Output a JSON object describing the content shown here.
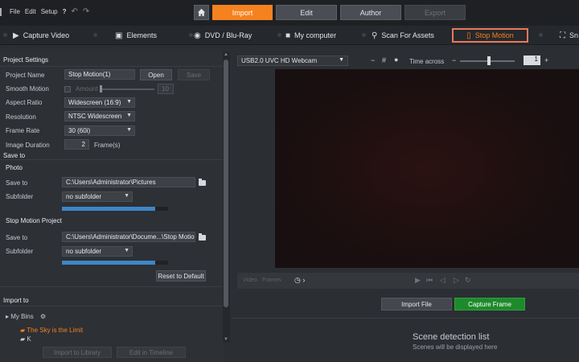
{
  "menu": {
    "items": [
      "File",
      "Edit",
      "Setup"
    ]
  },
  "top_tabs": [
    {
      "label": "Import",
      "state": "active"
    },
    {
      "label": "Edit",
      "state": "normal"
    },
    {
      "label": "Author",
      "state": "normal"
    },
    {
      "label": "Export",
      "state": "disabled"
    }
  ],
  "sources": {
    "capture_video": "Capture Video",
    "elements": "Elements",
    "dvd": "DVD / Blu-Ray",
    "my_computer": "My computer",
    "scan": "Scan For Assets",
    "stop_motion": "Stop Motion",
    "more": "Sn"
  },
  "project_settings": {
    "header": "Project Settings",
    "project_name_label": "Project Name",
    "project_name_value": "Stop Motion(1)",
    "open_button": "Open",
    "save_button": "Save",
    "smooth_motion_label": "Smooth Motion",
    "amount_label": "Amount",
    "amount_value": "10",
    "aspect_ratio_label": "Aspect Ratio",
    "aspect_ratio_value": "Widescreen (16:9)",
    "resolution_label": "Resolution",
    "resolution_value": "NTSC Widescreen",
    "frame_rate_label": "Frame Rate",
    "frame_rate_value": "30 (60i)",
    "image_duration_label": "Image Duration",
    "image_duration_value": "2",
    "image_duration_unit": "Frame(s)"
  },
  "save_to": {
    "header": "Save to",
    "photo": {
      "header": "Photo",
      "save_to_label": "Save to",
      "path": "C:\\Users\\Administrator\\Pictures",
      "subfolder_label": "Subfolder",
      "subfolder_value": "no subfolder",
      "space_fraction": 0.88
    },
    "project": {
      "header": "Stop Motion Project",
      "save_to_label": "Save to",
      "path": "C:\\Users\\Administrator\\Docume...\\Stop Motion",
      "subfolder_label": "Subfolder",
      "subfolder_value": "no subfolder",
      "space_fraction": 0.88
    },
    "reset_button": "Reset to Default"
  },
  "import_to": {
    "header": "Import to",
    "my_bins_label": "My Bins",
    "bins": [
      "The Sky is the Limit",
      "K"
    ],
    "import_library_button": "Import to Library",
    "edit_timeline_button": "Edit in Timeline"
  },
  "capture": {
    "camera_device": "USB2.0 UVC HD Webcam",
    "time_across_label": "Time across",
    "time_across_value": "1",
    "transport_video": "Video",
    "transport_frames": "Frames",
    "import_file_button": "Import File",
    "capture_frame_button": "Capture Frame"
  },
  "scene_detection": {
    "title": "Scene detection list",
    "subtitle": "Scenes will be displayed here"
  },
  "colors": {
    "accent_orange": "#f5821f",
    "capture_green": "#1f8a2c",
    "progress_blue": "#3e86c7",
    "highlight_border": "#e77a5a"
  }
}
